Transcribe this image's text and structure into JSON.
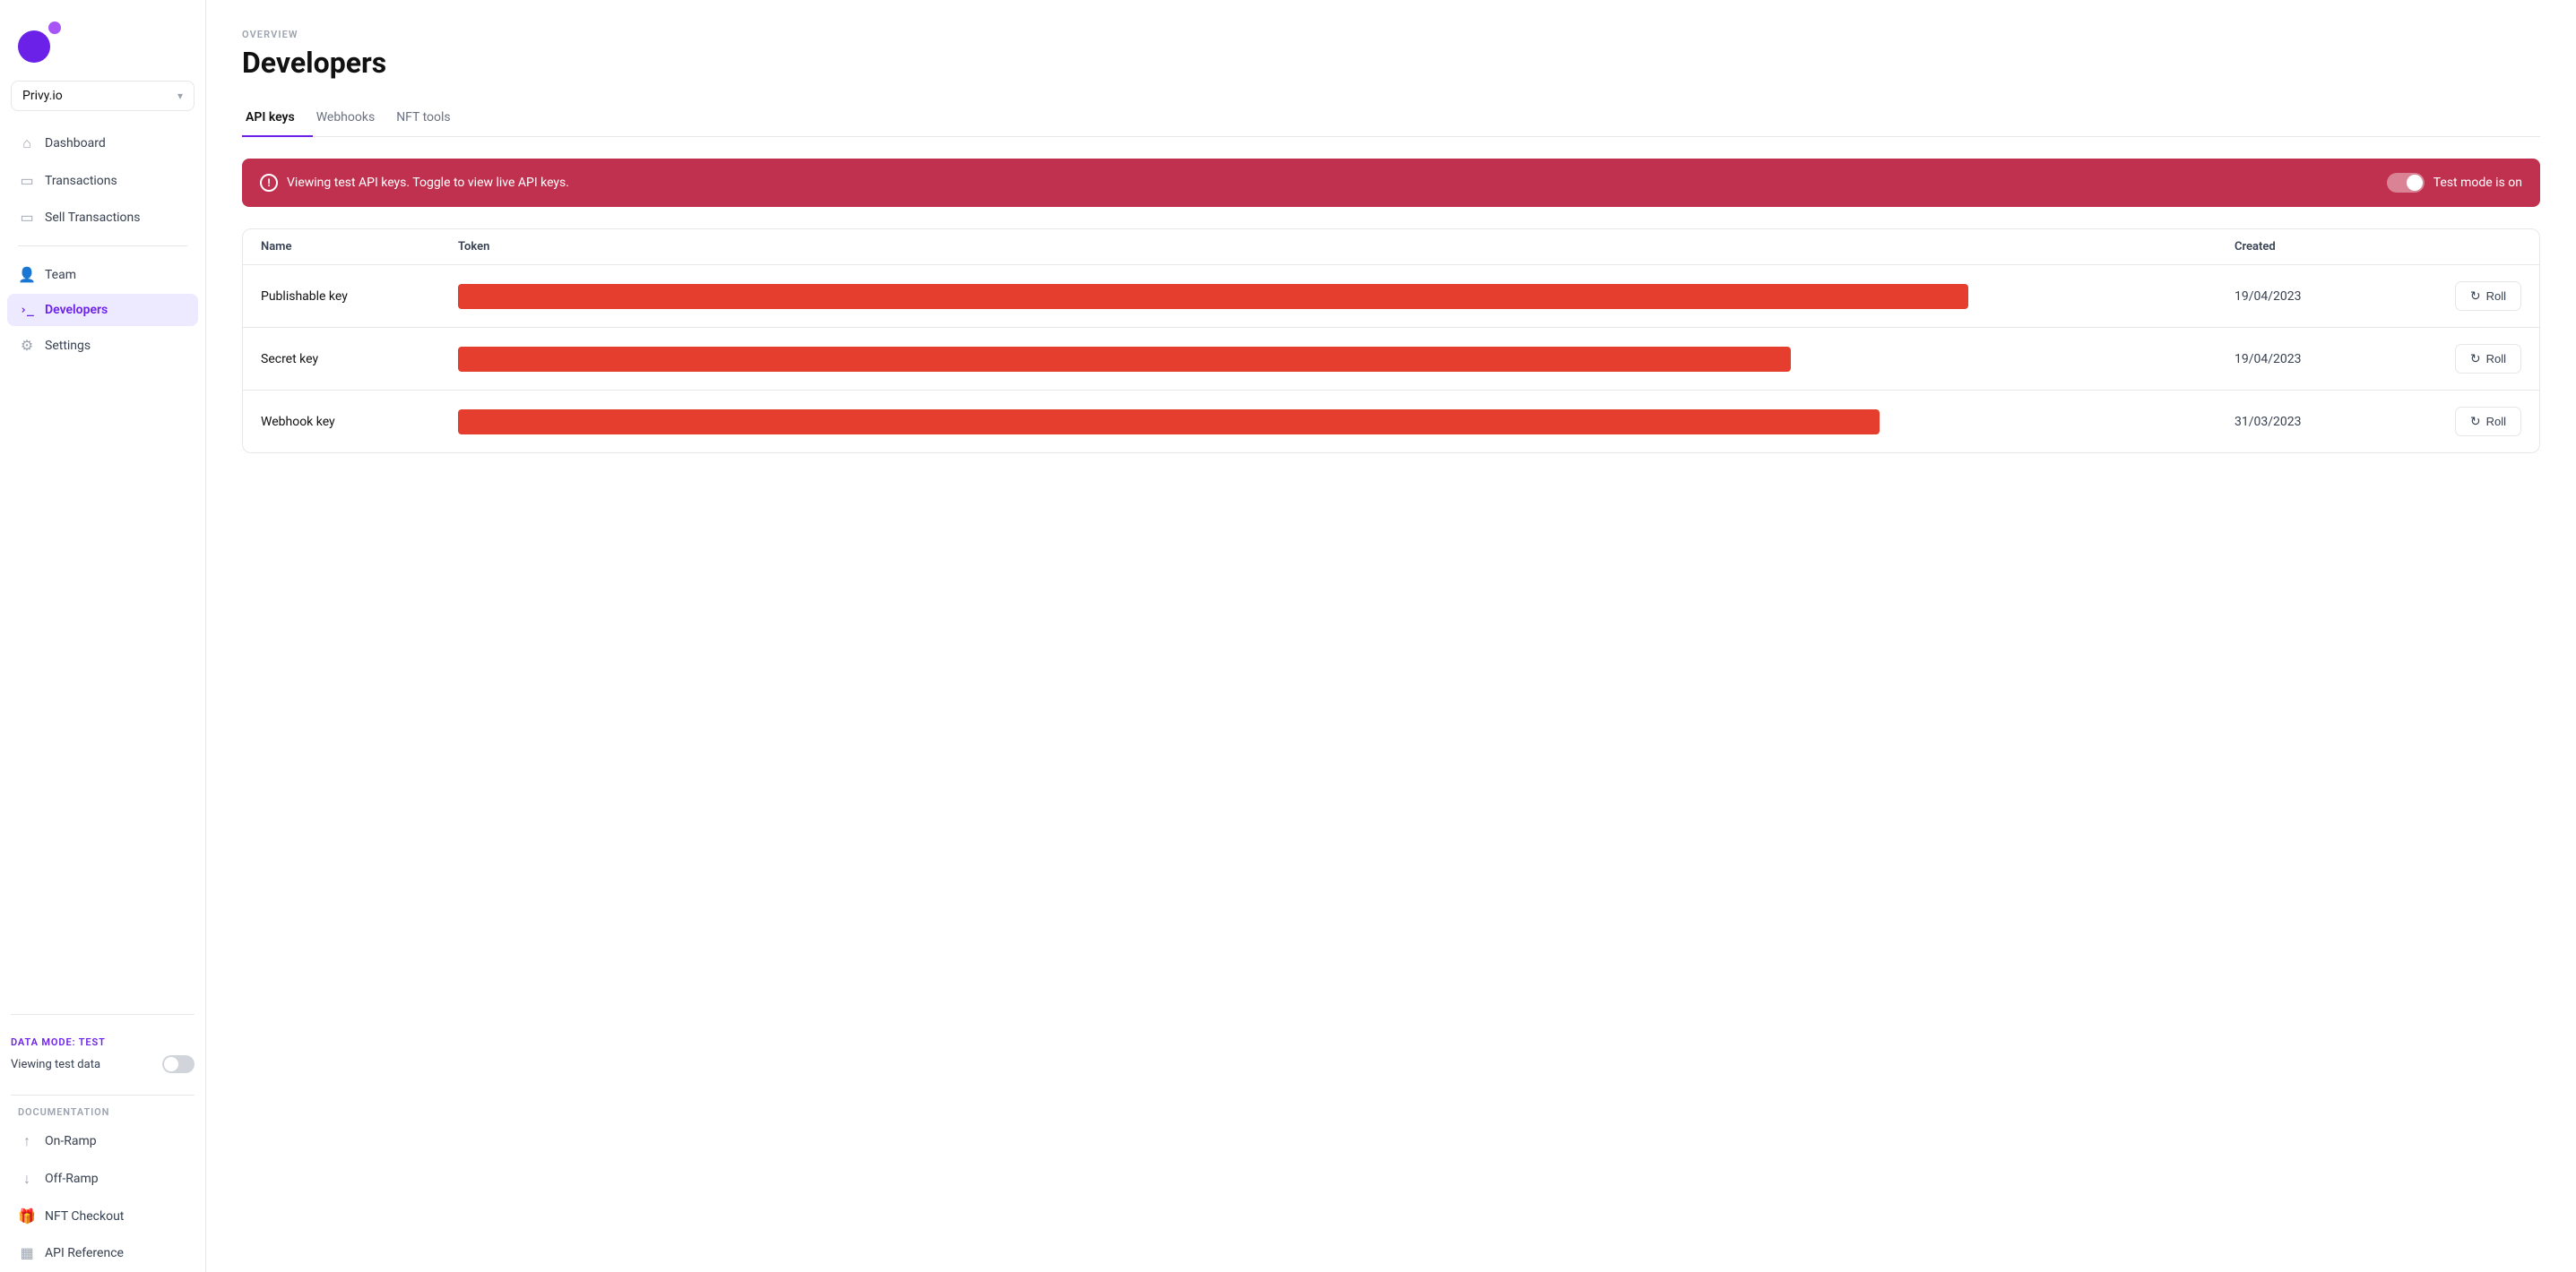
{
  "sidebar": {
    "workspace": "Privy.io",
    "nav_items": [
      {
        "id": "dashboard",
        "label": "Dashboard",
        "icon": "⌂",
        "active": false
      },
      {
        "id": "transactions",
        "label": "Transactions",
        "icon": "▭",
        "active": false
      },
      {
        "id": "sell-transactions",
        "label": "Sell Transactions",
        "icon": "▭",
        "active": false
      },
      {
        "id": "team",
        "label": "Team",
        "icon": "👤",
        "active": false
      },
      {
        "id": "developers",
        "label": "Developers",
        "icon": ">_",
        "active": true
      },
      {
        "id": "settings",
        "label": "Settings",
        "icon": "⚙",
        "active": false
      }
    ],
    "data_mode_label": "DATA MODE:",
    "data_mode_value": "TEST",
    "viewing_test_data": "Viewing test data",
    "doc_section_label": "DOCUMENTATION",
    "doc_items": [
      {
        "id": "on-ramp",
        "label": "On-Ramp",
        "icon": "↑"
      },
      {
        "id": "off-ramp",
        "label": "Off-Ramp",
        "icon": "↓"
      },
      {
        "id": "nft-checkout",
        "label": "NFT Checkout",
        "icon": "🎁"
      },
      {
        "id": "api-reference",
        "label": "API Reference",
        "icon": "▦"
      }
    ]
  },
  "page": {
    "overview_label": "OVERVIEW",
    "title": "Developers",
    "tabs": [
      {
        "id": "api-keys",
        "label": "API keys",
        "active": true
      },
      {
        "id": "webhooks",
        "label": "Webhooks",
        "active": false
      },
      {
        "id": "nft-tools",
        "label": "NFT tools",
        "active": false
      }
    ]
  },
  "alert": {
    "message": "Viewing test API keys. Toggle to view live API keys.",
    "toggle_label": "Test mode is on"
  },
  "table": {
    "columns": [
      "Name",
      "Token",
      "Created",
      ""
    ],
    "rows": [
      {
        "name": "Publishable key",
        "created": "19/04/2023",
        "roll_label": "Roll"
      },
      {
        "name": "Secret key",
        "created": "19/04/2023",
        "roll_label": "Roll"
      },
      {
        "name": "Webhook key",
        "created": "31/03/2023",
        "roll_label": "Roll"
      }
    ]
  }
}
